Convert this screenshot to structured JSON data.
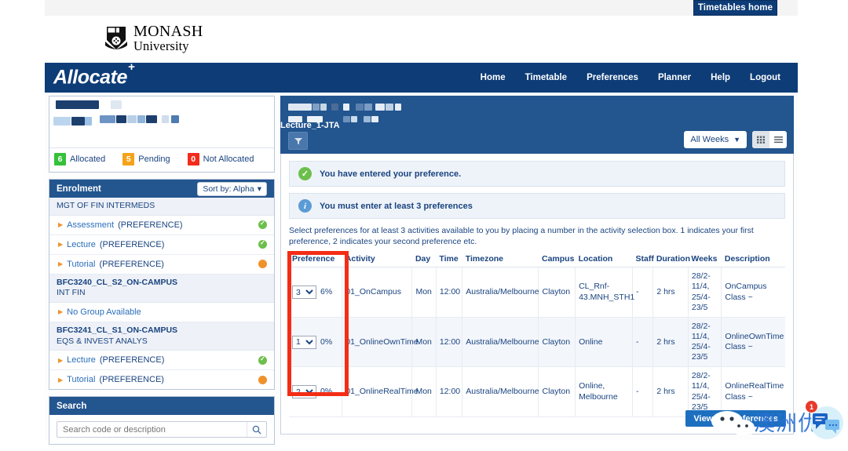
{
  "top": {
    "timetables_home": "Timetables home"
  },
  "brand": {
    "logo_line1": "MONASH",
    "logo_line2": "University",
    "app_name": "Allocate",
    "app_sup": "+"
  },
  "nav": {
    "items": [
      {
        "label": "Home"
      },
      {
        "label": "Timetable"
      },
      {
        "label": "Preferences"
      },
      {
        "label": "Planner"
      },
      {
        "label": "Help"
      },
      {
        "label": "Logout"
      }
    ]
  },
  "sidebar": {
    "status": [
      {
        "count": "6",
        "label": "Allocated",
        "color": "#35c13a"
      },
      {
        "count": "5",
        "label": "Pending",
        "color": "#f5a31a"
      },
      {
        "count": "0",
        "label": "Not Allocated",
        "color": "#f22c1b"
      }
    ],
    "enrolment": {
      "title": "Enrolment",
      "sort_label": "Sort by: Alpha",
      "groups": [
        {
          "code": "",
          "name": "MGT OF FIN INTERMEDS",
          "rows": [
            {
              "name": "Assessment",
              "pref": "(PREFERENCE)",
              "status": "green"
            },
            {
              "name": "Lecture",
              "pref": "(PREFERENCE)",
              "status": "green"
            },
            {
              "name": "Tutorial",
              "pref": "(PREFERENCE)",
              "status": "orange"
            }
          ]
        },
        {
          "code": "BFC3240_CL_S2_ON-CAMPUS",
          "name": "INT FIN",
          "rows": [
            {
              "name": "No Group Available",
              "pref": "",
              "status": "none"
            }
          ]
        },
        {
          "code": "BFC3241_CL_S1_ON-CAMPUS",
          "name": "EQS & INVEST ANALYS",
          "rows": [
            {
              "name": "Lecture",
              "pref": "(PREFERENCE)",
              "status": "green"
            },
            {
              "name": "Tutorial",
              "pref": "(PREFERENCE)",
              "status": "orange"
            }
          ]
        }
      ]
    },
    "search": {
      "title": "Search",
      "placeholder": "Search code or description",
      "value": ""
    }
  },
  "main": {
    "header": {
      "activity_label": "Lecture_1-JTA",
      "weeks_filter": "All Weeks"
    },
    "alerts": [
      {
        "icon": "check-icon",
        "text": "You have entered your preference."
      },
      {
        "icon": "info-icon",
        "text": "You must enter at least 3 preferences"
      }
    ],
    "instructions": "Select preferences for at least 3 activities available to you by placing a number in the activity selection box. 1 indicates your first preference, 2 indicates your second preference etc.",
    "table": {
      "columns": [
        "Preference",
        "Activity",
        "Day",
        "Time",
        "Timezone",
        "Campus",
        "Location",
        "Staff",
        "Duration",
        "Weeks",
        "Description"
      ],
      "rows": [
        {
          "preference": "3",
          "percent": "6%",
          "activity": "01_OnCampus",
          "day": "Mon",
          "time": "12:00",
          "timezone": "Australia/Melbourne",
          "campus": "Clayton",
          "location": "CL_Rnf-43.MNH_STH1",
          "staff": "-",
          "duration": "2 hrs",
          "weeks": "28/2-11/4, 25/4-23/5",
          "description": "OnCampus Class ~"
        },
        {
          "preference": "1",
          "percent": "0%",
          "activity": "01_OnlineOwnTime",
          "day": "Mon",
          "time": "12:00",
          "timezone": "Australia/Melbourne",
          "campus": "Clayton",
          "location": "Online",
          "staff": "-",
          "duration": "2 hrs",
          "weeks": "28/2-11/4, 25/4-23/5",
          "description": "OnlineOwnTime Class ~"
        },
        {
          "preference": "2",
          "percent": "0%",
          "activity": "01_OnlineRealTime",
          "day": "Mon",
          "time": "12:00",
          "timezone": "Australia/Melbourne",
          "campus": "Clayton",
          "location": "Online, Melbourne",
          "staff": "-",
          "duration": "2 hrs",
          "weeks": "28/2-11/4, 25/4-23/5",
          "description": "OnlineRealTime Class ~"
        }
      ],
      "preference_options": [
        "",
        "1",
        "2",
        "3"
      ]
    },
    "view_all_button": "View All Preferences"
  },
  "watermark": {
    "text": "澳洲优你",
    "badge": "1"
  },
  "colors": {
    "navy": "#0d3c77",
    "panel_header": "#23558f",
    "link": "#2a6ebb",
    "highlight_box": "#f42d16",
    "button_blue": "#1d6fc0"
  }
}
